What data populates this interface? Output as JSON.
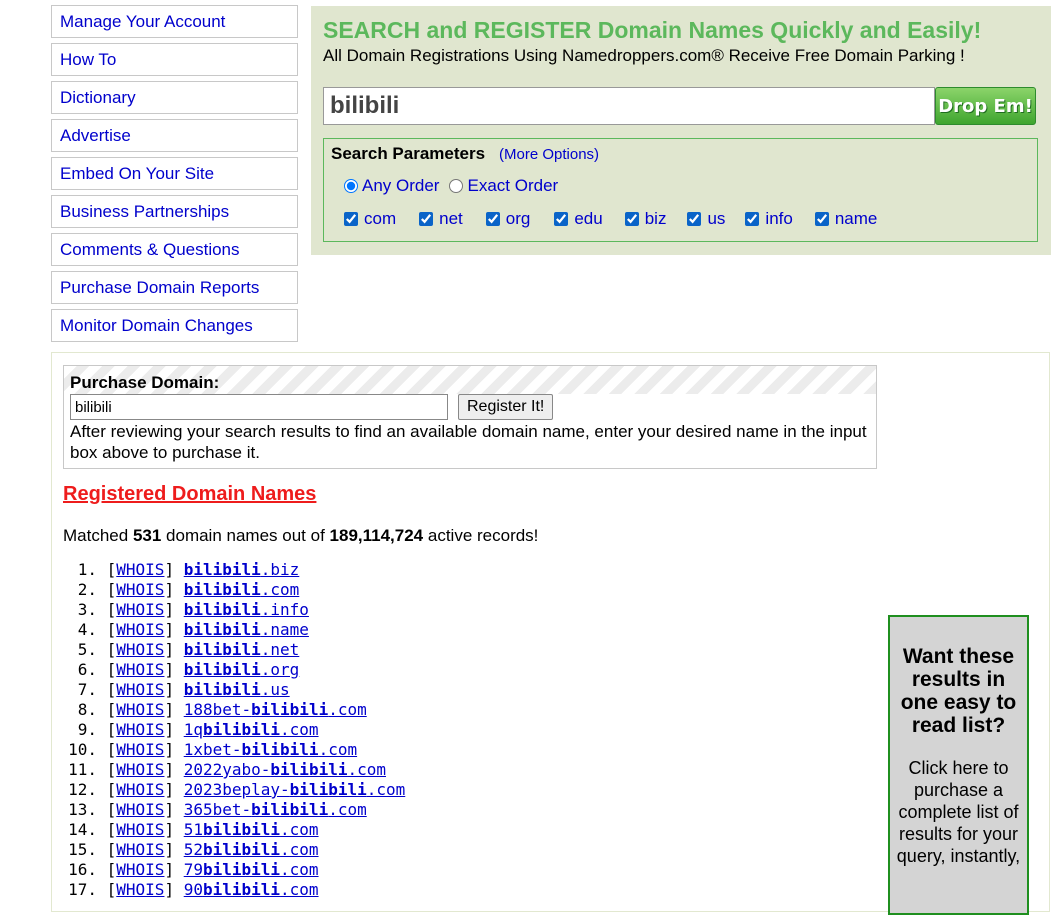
{
  "sidebar": {
    "items": [
      {
        "label": "Manage Your Account"
      },
      {
        "label": "How To"
      },
      {
        "label": "Dictionary"
      },
      {
        "label": "Advertise"
      },
      {
        "label": "Embed On Your Site"
      },
      {
        "label": "Business Partnerships"
      },
      {
        "label": "Comments & Questions"
      },
      {
        "label": "Purchase Domain Reports"
      },
      {
        "label": "Monitor Domain Changes"
      }
    ]
  },
  "search": {
    "heading": "SEARCH and REGISTER Domain Names Quickly and Easily!",
    "subheading": "All Domain Registrations Using Namedroppers.com® Receive Free Domain Parking !",
    "query": "bilibili",
    "button_label": "Drop Em!",
    "params_title": "Search Parameters",
    "more_options": "(More Options)",
    "order_options": [
      {
        "label": "Any Order",
        "selected": true
      },
      {
        "label": "Exact Order",
        "selected": false
      }
    ],
    "extensions": [
      {
        "label": "com",
        "checked": true
      },
      {
        "label": "net",
        "checked": true
      },
      {
        "label": "org",
        "checked": true
      },
      {
        "label": "edu",
        "checked": true
      },
      {
        "label": "biz",
        "checked": true
      },
      {
        "label": "us",
        "checked": true
      },
      {
        "label": "info",
        "checked": true
      },
      {
        "label": "name",
        "checked": true
      }
    ]
  },
  "purchase": {
    "title": "Purchase Domain:",
    "value": "bilibili",
    "button_label": "Register It!",
    "help": "After reviewing your search results to find an available domain name, enter your desired name in the input box above to purchase it."
  },
  "results": {
    "heading": "Registered Domain Names",
    "match_prefix": "Matched ",
    "matched_count": "531",
    "match_middle": " domain names out of ",
    "total_count": "189,114,724",
    "match_suffix": " active records!",
    "whois_label": "WHOIS",
    "rows": [
      {
        "num": "1.",
        "pre": "",
        "bold": "bilibili",
        "post": ".biz"
      },
      {
        "num": "2.",
        "pre": "",
        "bold": "bilibili",
        "post": ".com"
      },
      {
        "num": "3.",
        "pre": "",
        "bold": "bilibili",
        "post": ".info"
      },
      {
        "num": "4.",
        "pre": "",
        "bold": "bilibili",
        "post": ".name"
      },
      {
        "num": "5.",
        "pre": "",
        "bold": "bilibili",
        "post": ".net"
      },
      {
        "num": "6.",
        "pre": "",
        "bold": "bilibili",
        "post": ".org"
      },
      {
        "num": "7.",
        "pre": "",
        "bold": "bilibili",
        "post": ".us"
      },
      {
        "num": "8.",
        "pre": "188bet-",
        "bold": "bilibili",
        "post": ".com"
      },
      {
        "num": "9.",
        "pre": "1q",
        "bold": "bilibili",
        "post": ".com"
      },
      {
        "num": "10.",
        "pre": "1xbet-",
        "bold": "bilibili",
        "post": ".com"
      },
      {
        "num": "11.",
        "pre": "2022yabo-",
        "bold": "bilibili",
        "post": ".com"
      },
      {
        "num": "12.",
        "pre": "2023beplay-",
        "bold": "bilibili",
        "post": ".com"
      },
      {
        "num": "13.",
        "pre": "365bet-",
        "bold": "bilibili",
        "post": ".com"
      },
      {
        "num": "14.",
        "pre": "51",
        "bold": "bilibili",
        "post": ".com"
      },
      {
        "num": "15.",
        "pre": "52",
        "bold": "bilibili",
        "post": ".com"
      },
      {
        "num": "16.",
        "pre": "79",
        "bold": "bilibili",
        "post": ".com"
      },
      {
        "num": "17.",
        "pre": "90",
        "bold": "bilibili",
        "post": ".com"
      }
    ]
  },
  "promo": {
    "title": "Want these results in one easy to read list?",
    "text": "Click here to purchase a complete list of results for your query, instantly,"
  }
}
